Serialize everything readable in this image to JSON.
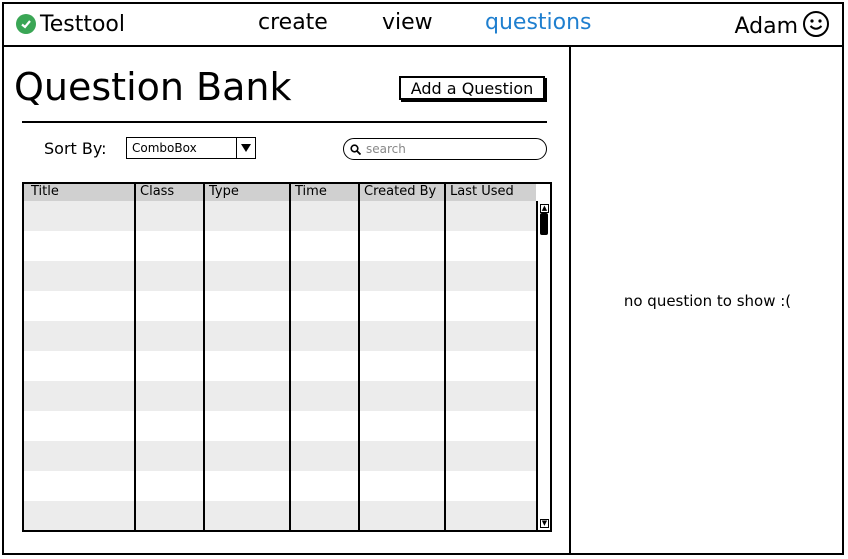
{
  "app": {
    "name": "Testtool",
    "logo_icon": "check-circle-icon",
    "accent": "#3aa655"
  },
  "nav": {
    "items": [
      {
        "label": "create"
      },
      {
        "label": "view"
      },
      {
        "label": "questions"
      }
    ],
    "active_color": "#1f7fcf"
  },
  "user": {
    "name": "Adam",
    "avatar_icon": "smiley-face-icon"
  },
  "main": {
    "title": "Question Bank",
    "add_button": "Add a Question",
    "sort_label": "Sort By:",
    "combo_value": "ComboBox",
    "search_placeholder": "search",
    "table": {
      "columns": [
        "Title",
        "Class",
        "Type",
        "Time",
        "Created By",
        "Last Used"
      ],
      "rows": [],
      "header_color": "#d0d0d0",
      "stripe_color": "#ececec"
    }
  },
  "detail": {
    "empty_message": "no question to show :("
  }
}
